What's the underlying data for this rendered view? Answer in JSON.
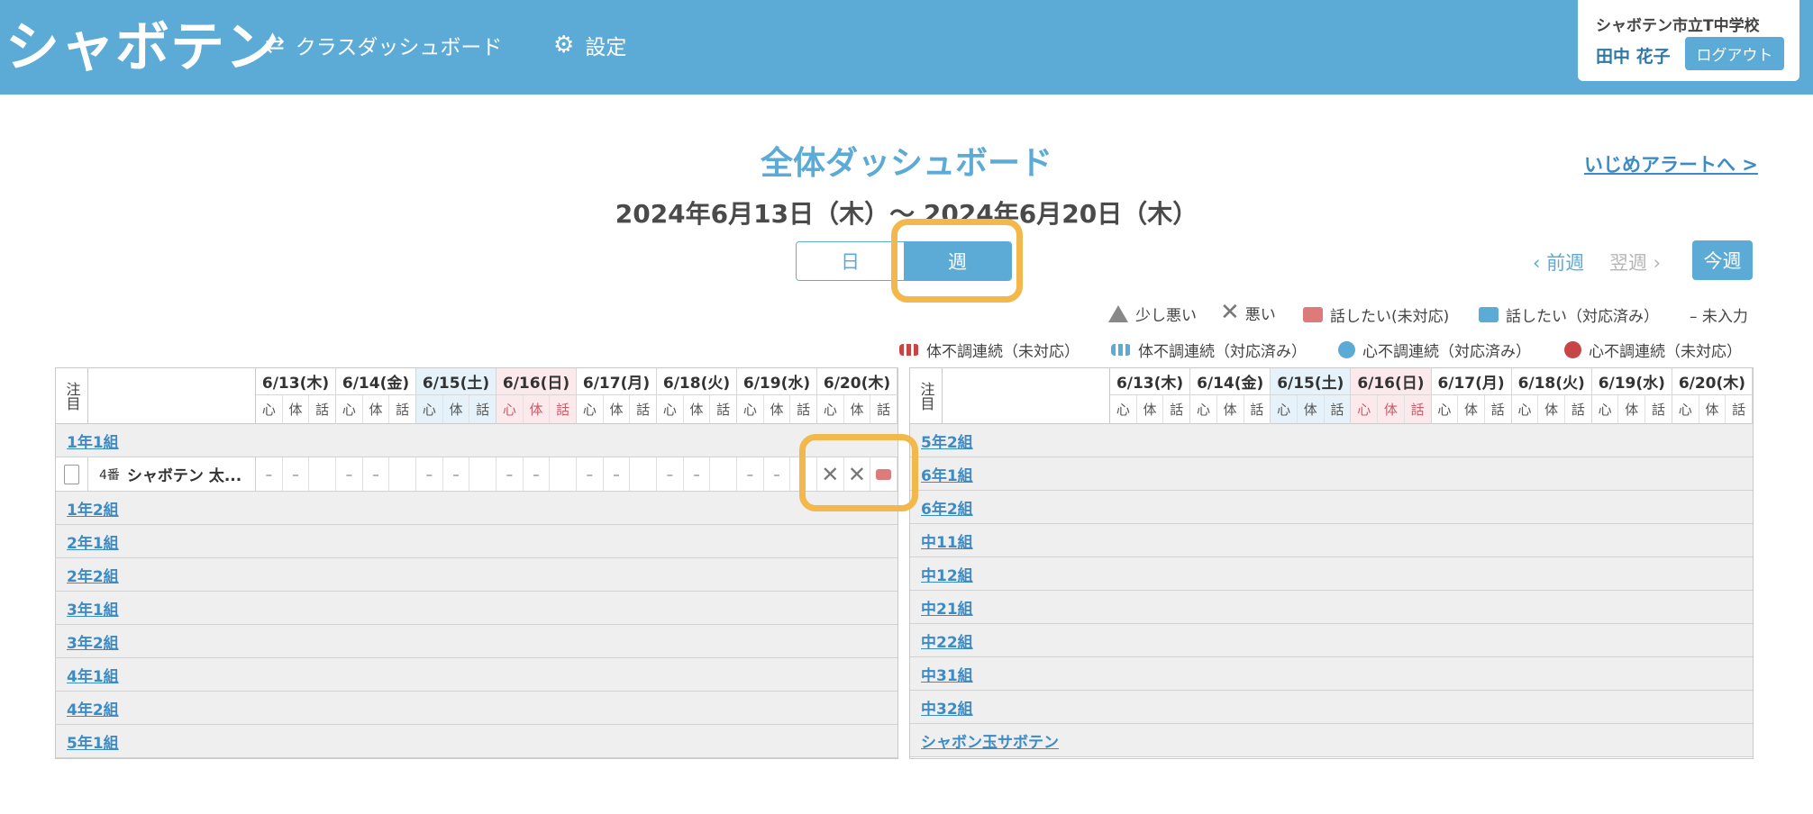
{
  "header": {
    "logo": "シャボテン",
    "nav_dashboard": "クラスダッシュボード",
    "nav_settings": "設定",
    "school": "シャボテン市立T中学校",
    "user_name": "田中 花子",
    "logout": "ログアウト"
  },
  "page": {
    "title": "全体ダッシュボード",
    "alert_link": "いじめアラートへ >",
    "date_range": "2024年6月13日（木）〜 2024年6月20日（木）",
    "toggle_day": "日",
    "toggle_week": "週",
    "prev_week": "前週",
    "next_week": "翌週",
    "this_week": "今週"
  },
  "legend": {
    "slightly_bad": "少し悪い",
    "bad": "悪い",
    "want_talk_open": "話したい(未対応)",
    "want_talk_done": "話したい（対応済み）",
    "not_entered": "– 未入力",
    "body_open": "体不調連続（未対応）",
    "body_done": "体不調連続（対応済み）",
    "mind_done": "心不調連続（対応済み）",
    "mind_open": "心不調連続（未対応）"
  },
  "table": {
    "focus_header": "注目",
    "dates": [
      "6/13(木)",
      "6/14(金)",
      "6/15(土)",
      "6/16(日)",
      "6/17(月)",
      "6/18(火)",
      "6/19(水)",
      "6/20(木)"
    ],
    "sub_cols": [
      "心",
      "体",
      "話"
    ],
    "left_groups": [
      "1年1組",
      "1年2組",
      "2年1組",
      "2年2組",
      "3年1組",
      "3年2組",
      "4年1組",
      "4年2組",
      "5年1組"
    ],
    "right_groups": [
      "5年2組",
      "6年1組",
      "6年2組",
      "中11組",
      "中12組",
      "中21組",
      "中22組",
      "中31組",
      "中32組",
      "シャボン玉サボテン"
    ],
    "student": {
      "number": "4番",
      "name": "シャボテン 太...",
      "cells": [
        "–",
        "–",
        "",
        "–",
        "–",
        "",
        "–",
        "–",
        "",
        "–",
        "–",
        "",
        "–",
        "–",
        "",
        "–",
        "–",
        "",
        "–",
        "–",
        "",
        "×",
        "×",
        "talk"
      ]
    }
  },
  "colors": {
    "primary": "#5babd6",
    "highlight": "#f2b84b",
    "alert_red": "#dd7b7b"
  }
}
